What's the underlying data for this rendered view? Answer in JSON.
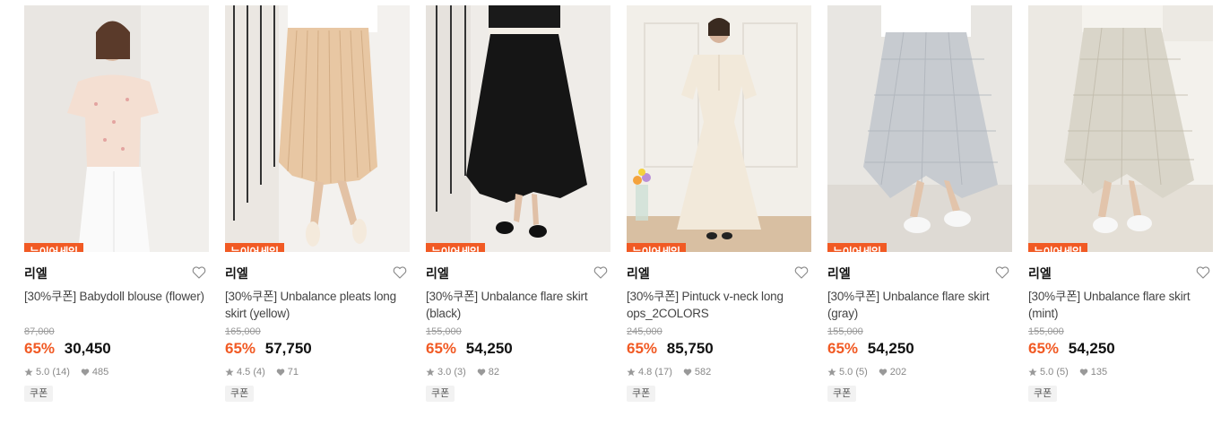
{
  "products": [
    {
      "badge": "뉴이어세일",
      "brand": "리엘",
      "title": "[30%쿠폰] Babydoll blouse (flower)",
      "original_price": "87,000",
      "discount": "65%",
      "price": "30,450",
      "rating": "5.0 (14)",
      "likes": "485",
      "tag": "쿠폰"
    },
    {
      "badge": "뉴이어세일",
      "brand": "리엘",
      "title": "[30%쿠폰] Unbalance pleats long skirt (yellow)",
      "original_price": "165,000",
      "discount": "65%",
      "price": "57,750",
      "rating": "4.5 (4)",
      "likes": "71",
      "tag": "쿠폰"
    },
    {
      "badge": "뉴이어세일",
      "brand": "리엘",
      "title": "[30%쿠폰] Unbalance flare skirt (black)",
      "original_price": "155,000",
      "discount": "65%",
      "price": "54,250",
      "rating": "3.0 (3)",
      "likes": "82",
      "tag": "쿠폰"
    },
    {
      "badge": "뉴이어세일",
      "brand": "리엘",
      "title": "[30%쿠폰] Pintuck v-neck long ops_2COLORS",
      "original_price": "245,000",
      "discount": "65%",
      "price": "85,750",
      "rating": "4.8 (17)",
      "likes": "582",
      "tag": "쿠폰"
    },
    {
      "badge": "뉴이어세일",
      "brand": "리엘",
      "title": "[30%쿠폰] Unbalance flare skirt (gray)",
      "original_price": "155,000",
      "discount": "65%",
      "price": "54,250",
      "rating": "5.0 (5)",
      "likes": "202",
      "tag": "쿠폰"
    },
    {
      "badge": "뉴이어세일",
      "brand": "리엘",
      "title": "[30%쿠폰] Unbalance flare skirt (mint)",
      "original_price": "155,000",
      "discount": "65%",
      "price": "54,250",
      "rating": "5.0 (5)",
      "likes": "135",
      "tag": "쿠폰"
    }
  ],
  "colors": {
    "accent": "#f15a24",
    "text": "#222222",
    "muted": "#999999"
  },
  "icons": {
    "wishlist": "heart-outline-icon",
    "rating": "star-icon",
    "likes": "heart-filled-icon"
  }
}
